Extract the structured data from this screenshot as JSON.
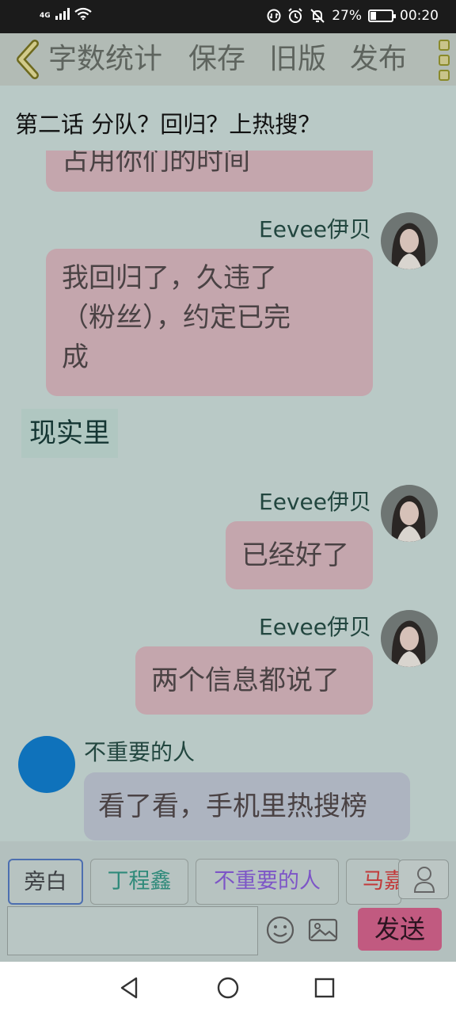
{
  "status_bar": {
    "network": "4G",
    "battery": "27%",
    "time": "00:20"
  },
  "toolbar": {
    "back_icon": "chevron-left-icon",
    "items": [
      "字数统计",
      "保存",
      "旧版",
      "发布"
    ],
    "menu_icon": "more-menu-icon"
  },
  "chapter": {
    "title": "第二话 分队？回归？上热搜？"
  },
  "messages": [
    {
      "type": "partial",
      "text": "占用你们的时间"
    },
    {
      "type": "right",
      "speaker": "Eevee伊贝",
      "lines": [
        "我回归了，久违了",
        "（粉丝），约定已完",
        "成"
      ]
    },
    {
      "type": "narration",
      "text": "现实里"
    },
    {
      "type": "right",
      "speaker": "Eevee伊贝",
      "text": "已经好了"
    },
    {
      "type": "right",
      "speaker": "Eevee伊贝",
      "text": "两个信息都说了"
    },
    {
      "type": "left",
      "speaker": "不重要的人",
      "text": "看了看，手机里热搜榜"
    }
  ],
  "characters": [
    {
      "label": "旁白",
      "color": "#3d4044",
      "selected": true
    },
    {
      "label": "丁程鑫",
      "color": "#2f8a7a",
      "selected": false
    },
    {
      "label": "不重要的人",
      "color": "#7d55c7",
      "selected": false
    },
    {
      "label": "马嘉",
      "color": "#c23a3a",
      "selected": false
    }
  ],
  "composer": {
    "value": "",
    "send_label": "发送",
    "emoji_icon": "emoji-icon",
    "image_icon": "image-icon",
    "person_icon": "person-icon"
  },
  "nav": {
    "back": "back-triangle-icon",
    "home": "home-circle-icon",
    "recent": "recent-square-icon"
  }
}
